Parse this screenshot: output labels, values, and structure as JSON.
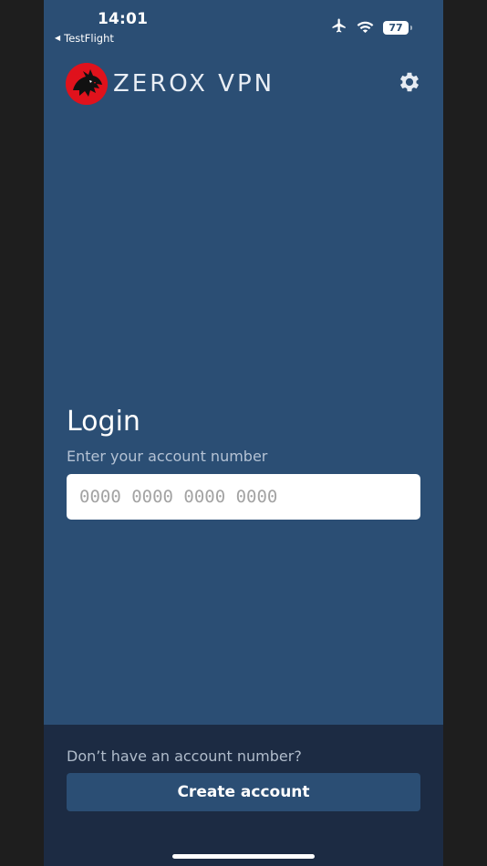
{
  "status_bar": {
    "time": "14:01",
    "back_app": "TestFlight",
    "battery_level": "77"
  },
  "header": {
    "brand": "ZEROX VPN",
    "logo_icon": "dragon-logo-icon",
    "settings_icon": "gear-icon"
  },
  "login": {
    "title": "Login",
    "subtitle": "Enter your account number",
    "input_placeholder": "0000 0000 0000 0000",
    "input_value": ""
  },
  "footer": {
    "prompt": "Don’t have an account number?",
    "create_label": "Create account"
  },
  "colors": {
    "background": "#2b4e74",
    "footer": "#1c2b43",
    "button": "#2b4e74",
    "logo_red": "#e0121c"
  }
}
